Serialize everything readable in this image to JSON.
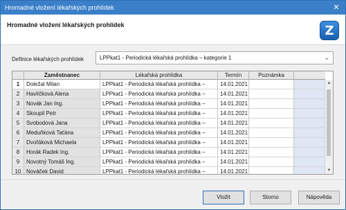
{
  "window": {
    "title": "Hromadné vložení lékařských prohlídek",
    "close_glyph": "✕"
  },
  "header": {
    "title": "Hromadné vložení lékařských prohlídek",
    "logo_glyph": "Z"
  },
  "definition": {
    "label": "Definice lékařských prohlídek",
    "value": "LPPkat1 - Periodická lékařská prohlídka – kategorie 1"
  },
  "table": {
    "columns": {
      "employee": "Zaměstnanec",
      "exam": "Lékařská prohlídka",
      "term": "Termín",
      "note": "Poznámka"
    },
    "rows": [
      {
        "num": "1",
        "employee": "Doležal Milan",
        "exam": "LPPkat1 - Periodická lékařská prohlídka –",
        "term": "14.01.2021",
        "note": ""
      },
      {
        "num": "2",
        "employee": "Havlíčková Alena",
        "exam": "LPPkat1 - Periodická lékařská prohlídka –",
        "term": "14.01.2021",
        "note": ""
      },
      {
        "num": "3",
        "employee": "Novák Jan Ing.",
        "exam": "LPPkat1 - Periodická lékařská prohlídka –",
        "term": "14.01.2021",
        "note": ""
      },
      {
        "num": "4",
        "employee": "Skoupil Petr",
        "exam": "LPPkat1 - Periodická lékařská prohlídka –",
        "term": "14.01.2021",
        "note": ""
      },
      {
        "num": "5",
        "employee": "Svobodová Jana",
        "exam": "LPPkat1 - Periodická lékařská prohlídka –",
        "term": "14.01.2021",
        "note": ""
      },
      {
        "num": "6",
        "employee": "Meduňková Taťána",
        "exam": "LPPkat1 - Periodická lékařská prohlídka –",
        "term": "14.01.2021",
        "note": ""
      },
      {
        "num": "7",
        "employee": "Dvořáková Michaela",
        "exam": "LPPkat1 - Periodická lékařská prohlídka –",
        "term": "14.01.2021",
        "note": ""
      },
      {
        "num": "8",
        "employee": "Horák Radek Ing.",
        "exam": "LPPkat1 - Periodická lékařská prohlídka –",
        "term": "14.01.2021",
        "note": ""
      },
      {
        "num": "9",
        "employee": "Novotný Tomáš Ing.",
        "exam": "LPPkat1 - Periodická lékařská prohlídka –",
        "term": "14.01.2021",
        "note": ""
      },
      {
        "num": "10",
        "employee": "Nováček David",
        "exam": "LPPkat1 - Periodická lékařská prohlídka –",
        "term": "14.01.2021",
        "note": ""
      }
    ]
  },
  "buttons": {
    "insert": "Vložit",
    "cancel": "Storno",
    "help": "Nápověda"
  }
}
